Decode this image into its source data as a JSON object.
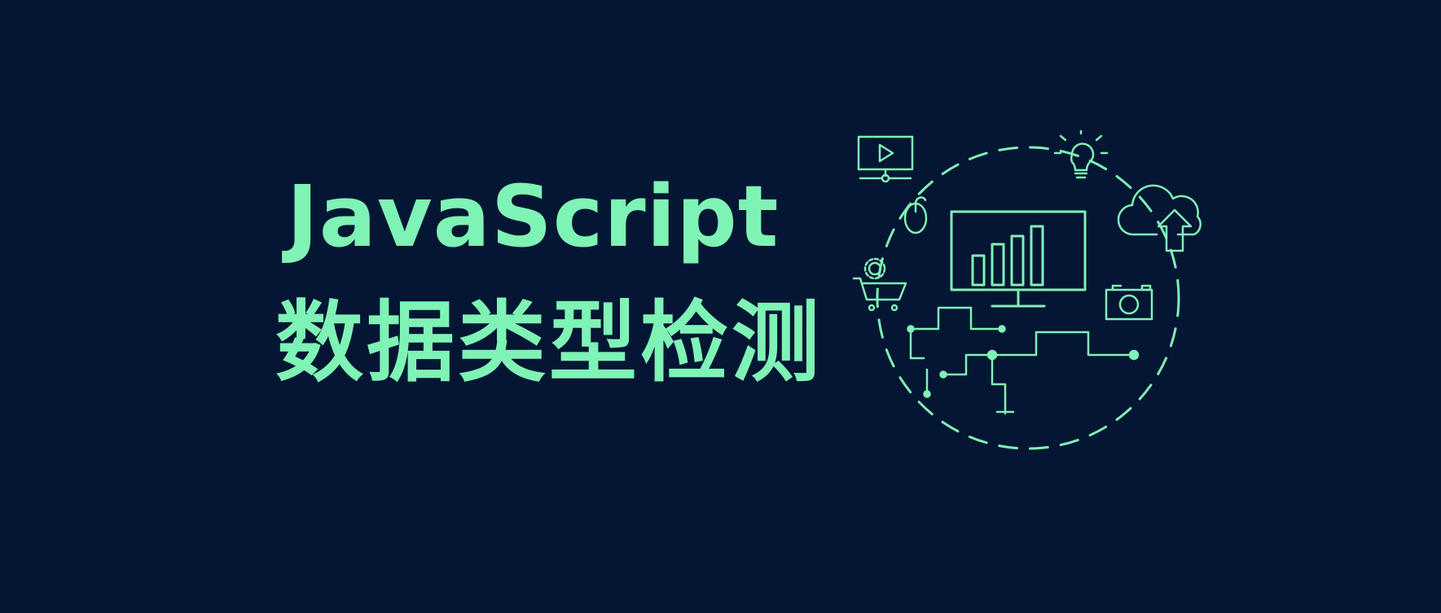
{
  "banner": {
    "title_line1": "JavaScript",
    "title_line2": "数据类型检测"
  },
  "colors": {
    "background": "#041633",
    "accent": "#7ff2b5"
  },
  "icons": [
    "video-monitor-icon",
    "lightbulb-icon",
    "cloud-upload-icon",
    "mouse-icon",
    "bar-chart-monitor-icon",
    "shopping-cart-icon",
    "camera-icon",
    "circuit-lines-icon"
  ]
}
